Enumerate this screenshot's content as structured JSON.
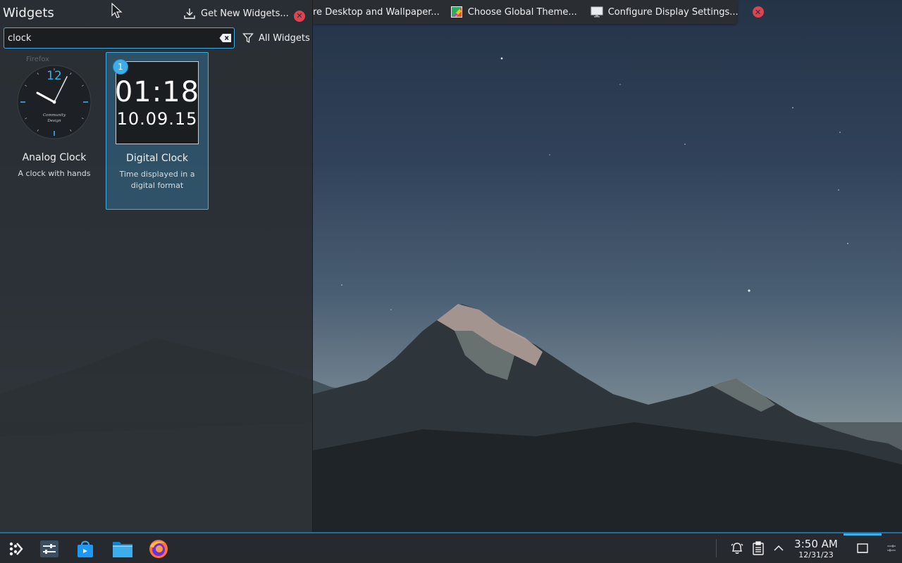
{
  "panel": {
    "title": "Widgets",
    "get_new_label": "Get New Widgets...",
    "search_value": "clock",
    "filter_label": "All Widgets"
  },
  "widgets": [
    {
      "name": "Analog Clock",
      "description": "A clock with hands",
      "preview_label": "Firefox",
      "preview_number": "12",
      "preview_text_1": "Community",
      "preview_text_2": "Design"
    },
    {
      "name": "Digital Clock",
      "description": "Time displayed in a digital format",
      "preview_time": "01:18",
      "preview_date": "10.09.15",
      "instance_count": "1",
      "selected": true
    }
  ],
  "toolbar": {
    "configure_desktop_label": "re Desktop and Wallpaper...",
    "global_theme_label": "Choose Global Theme...",
    "display_settings_label": "Configure Display Settings..."
  },
  "taskbar": {
    "launchers": [
      "application-launcher-icon",
      "system-settings-icon",
      "discover-store-icon",
      "file-manager-icon",
      "firefox-icon"
    ],
    "tray": [
      "notifications-icon",
      "clipboard-icon",
      "expand-tray-icon"
    ],
    "clock_time": "3:50 AM",
    "clock_date": "12/31/23"
  },
  "colors": {
    "accent": "#3daee9",
    "close_red": "#da4453",
    "panel_bg": "#2a2e33"
  }
}
